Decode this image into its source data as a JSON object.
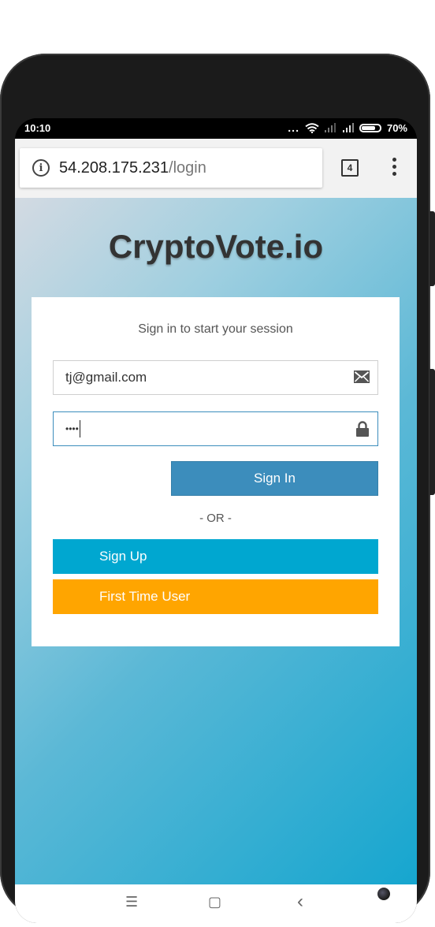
{
  "status_bar": {
    "time": "10:10",
    "dots": "...",
    "battery": "70%"
  },
  "browser": {
    "url_host": "54.208.175.231",
    "url_path": "/login",
    "tab_count": "4"
  },
  "page": {
    "title": "CryptoVote.io",
    "subtitle": "Sign in to start your session",
    "email_value": "tj@gmail.com",
    "password_mask": "••••",
    "signin_label": "Sign In",
    "or_label": "- OR -",
    "signup_label": "Sign Up",
    "first_time_label": "First Time User"
  },
  "colors": {
    "signin": "#3c8dbc",
    "signup": "#00a7d0",
    "first_time": "#ffa500",
    "title": "#333333"
  },
  "icons": {
    "email": "envelope-icon",
    "password": "lock-icon",
    "info": "info-icon",
    "menu": "overflow-menu-icon"
  },
  "nav": {
    "menu": "☰",
    "home": "▢",
    "back": "‹"
  }
}
